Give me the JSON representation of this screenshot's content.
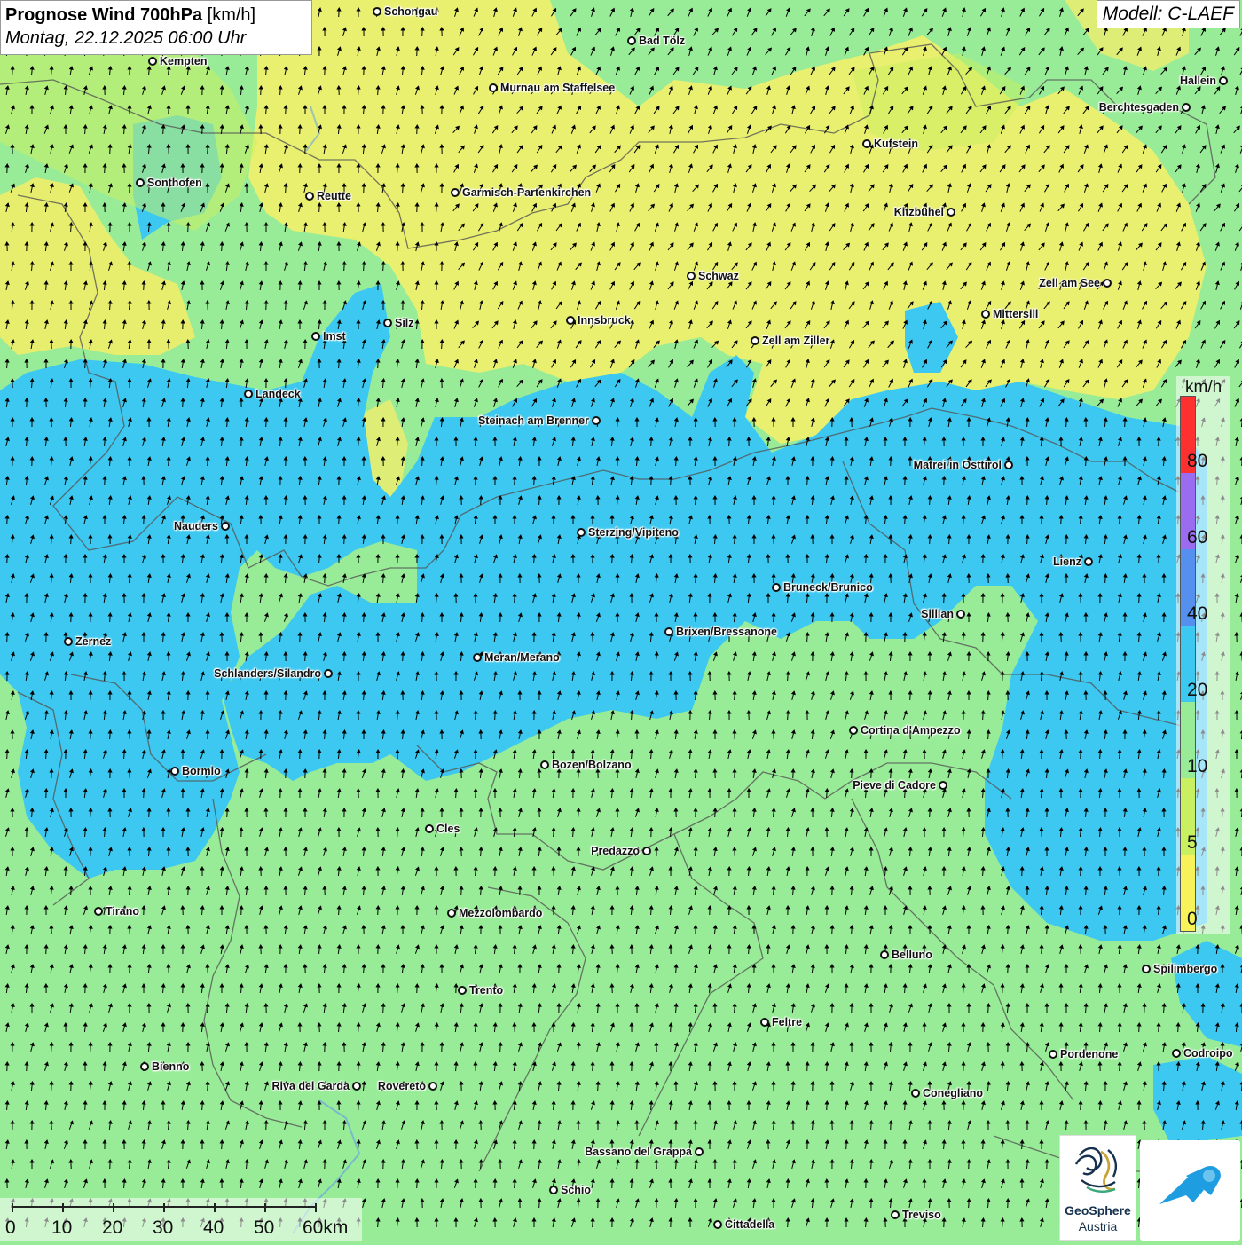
{
  "header": {
    "title_bold": "Prognose Wind 700hPa",
    "title_unit": "[km/h]",
    "date": "Montag, 22.12.2025 06:00 Uhr",
    "model": "Modell: C-LAEF"
  },
  "legend": {
    "unit": "km/h",
    "ticks": [
      "80",
      "60",
      "40",
      "20",
      "10",
      "5",
      "0"
    ],
    "colors": [
      "#ff3030",
      "#9a6cf0",
      "#5590ee",
      "#3cc8f0",
      "#98ec97",
      "#c8f060",
      "#f8f25a"
    ]
  },
  "scale_bar": {
    "labels": [
      "0",
      "10",
      "20",
      "30",
      "40",
      "50",
      "60km"
    ]
  },
  "cities": [
    {
      "name": "Schongau"
    },
    {
      "name": "Kempten"
    },
    {
      "name": "Bad Tölz"
    },
    {
      "name": "Murnau am Staffelsee"
    },
    {
      "name": "Hallein"
    },
    {
      "name": "Berchtesgaden"
    },
    {
      "name": "Kufstein"
    },
    {
      "name": "Sonthofen"
    },
    {
      "name": "Reutte"
    },
    {
      "name": "Garmisch-Partenkirchen"
    },
    {
      "name": "Kitzbühel"
    },
    {
      "name": "Schwaz"
    },
    {
      "name": "Zell am See"
    },
    {
      "name": "Mittersill"
    },
    {
      "name": "Imst"
    },
    {
      "name": "Silz"
    },
    {
      "name": "Innsbruck"
    },
    {
      "name": "Zell am Ziller"
    },
    {
      "name": "Landeck"
    },
    {
      "name": "Steinach am Brenner"
    },
    {
      "name": "Matrei in Osttirol"
    },
    {
      "name": "Nauders"
    },
    {
      "name": "Sterzing/Vipiteno"
    },
    {
      "name": "Lienz"
    },
    {
      "name": "Bruneck/Brunico"
    },
    {
      "name": "Sillian"
    },
    {
      "name": "Brixen/Bressanone"
    },
    {
      "name": "Zernez"
    },
    {
      "name": "Meran/Merano"
    },
    {
      "name": "Schlanders/Silandro"
    },
    {
      "name": "Cortina d'Ampezzo"
    },
    {
      "name": "Bozen/Bolzano"
    },
    {
      "name": "Bormio"
    },
    {
      "name": "Pieve di Cadore"
    },
    {
      "name": "Cles"
    },
    {
      "name": "Predazzo"
    },
    {
      "name": "Tirano"
    },
    {
      "name": "Mezzolombardo"
    },
    {
      "name": "Belluno"
    },
    {
      "name": "Spilimbergo"
    },
    {
      "name": "Trento"
    },
    {
      "name": "Feltre"
    },
    {
      "name": "Bienno"
    },
    {
      "name": "Pordenone"
    },
    {
      "name": "Codroipo"
    },
    {
      "name": "Riva del Garda"
    },
    {
      "name": "Rovereto"
    },
    {
      "name": "Conegliano"
    },
    {
      "name": "Bassano del Grappa"
    },
    {
      "name": "Schio"
    },
    {
      "name": "Treviso"
    },
    {
      "name": "Cittadella"
    }
  ],
  "logos": {
    "geosphere_name": "GeoSphere",
    "geosphere_sub": "Austria"
  },
  "colors": {
    "wind_0_5": "#f8f25a",
    "wind_5_10": "#c8f060",
    "wind_10_20": "#98ec97",
    "wind_20_40": "#3cc8f0",
    "arrow": "#000000",
    "border": "#555555"
  }
}
